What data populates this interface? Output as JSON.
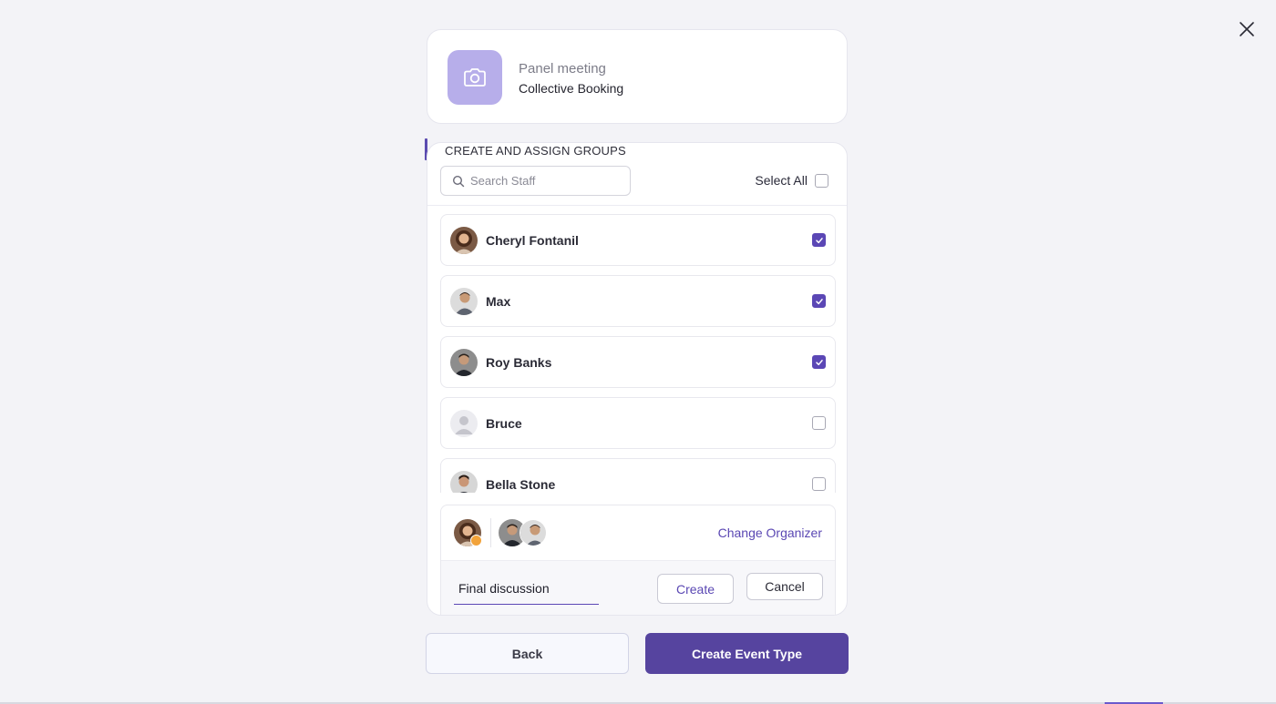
{
  "event": {
    "name": "Panel meeting",
    "type": "Collective Booking",
    "icon": "camera-icon",
    "icon_bg": "#b7aeea"
  },
  "section": {
    "title": "CREATE AND ASSIGN GROUPS"
  },
  "search": {
    "placeholder": "Search Staff",
    "value": ""
  },
  "select_all": {
    "label": "Select All",
    "checked": false
  },
  "staff": [
    {
      "name": "Cheryl Fontanil",
      "checked": true
    },
    {
      "name": "Max",
      "checked": true
    },
    {
      "name": "Roy Banks",
      "checked": true
    },
    {
      "name": "Bruce",
      "checked": false
    },
    {
      "name": "Bella Stone",
      "checked": false
    }
  ],
  "organizer": {
    "change_label": "Change Organizer"
  },
  "group_form": {
    "name_value": "Final discussion",
    "create_label": "Create",
    "cancel_label": "Cancel"
  },
  "footer": {
    "back_label": "Back",
    "primary_label": "Create Event Type"
  },
  "colors": {
    "accent": "#5b47b5",
    "primary_button": "#56449f",
    "background": "#f3f3f7"
  }
}
